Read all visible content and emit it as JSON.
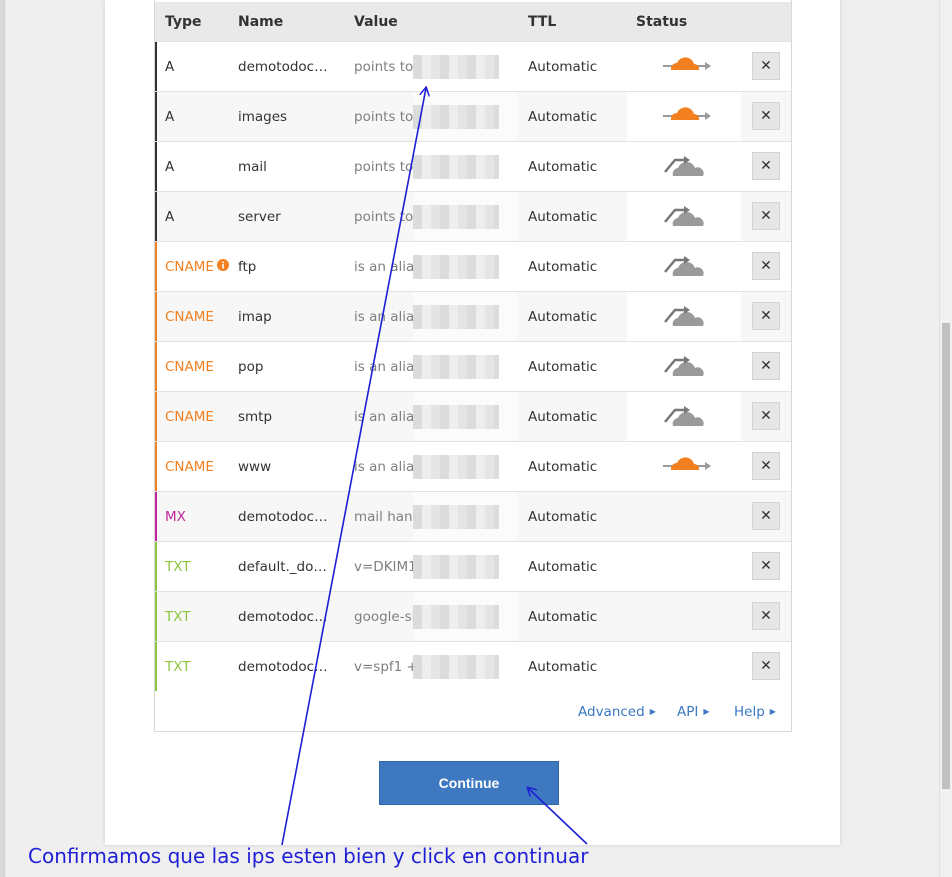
{
  "table": {
    "columns": [
      "Type",
      "Name",
      "Value",
      "TTL",
      "Status"
    ],
    "rows": [
      {
        "type": "A",
        "name": "demotodocu…",
        "value": "points to",
        "ttl": "Automatic",
        "proxied": true
      },
      {
        "type": "A",
        "name": "images",
        "value": "points to",
        "ttl": "Automatic",
        "proxied": true
      },
      {
        "type": "A",
        "name": "mail",
        "value": "points to",
        "ttl": "Automatic",
        "proxied": false
      },
      {
        "type": "A",
        "name": "server",
        "value": "points to",
        "ttl": "Automatic",
        "proxied": false
      },
      {
        "type": "CNAME",
        "name": "ftp",
        "value": "is an alias",
        "ttl": "Automatic",
        "proxied": false,
        "info": true
      },
      {
        "type": "CNAME",
        "name": "imap",
        "value": "is an alias",
        "ttl": "Automatic",
        "proxied": false
      },
      {
        "type": "CNAME",
        "name": "pop",
        "value": "is an alias",
        "ttl": "Automatic",
        "proxied": false
      },
      {
        "type": "CNAME",
        "name": "smtp",
        "value": "is an alias",
        "ttl": "Automatic",
        "proxied": false
      },
      {
        "type": "CNAME",
        "name": "www",
        "value": "is an alias",
        "ttl": "Automatic",
        "proxied": true
      },
      {
        "type": "MX",
        "name": "demotodocu…",
        "value": "mail hand",
        "ttl": "Automatic",
        "proxied": null
      },
      {
        "type": "TXT",
        "name": "default._dom…",
        "value": "v=DKIM1;",
        "ttl": "Automatic",
        "proxied": null
      },
      {
        "type": "TXT",
        "name": "demotodocu…",
        "value": "google-sit",
        "ttl": "Automatic",
        "proxied": null
      },
      {
        "type": "TXT",
        "name": "demotodocu…",
        "value": "v=spf1 +a",
        "ttl": "Automatic",
        "proxied": null
      }
    ],
    "delete_glyph": "✕"
  },
  "links": {
    "advanced": "Advanced",
    "api": "API",
    "help": "Help"
  },
  "continue_label": "Continue",
  "annotation": "Confirmamos que las ips esten bien y click en continuar",
  "colors": {
    "type_A": "#333333",
    "type_CNAME": "#f38020",
    "type_MX": "#c2269b",
    "type_TXT": "#8cc63f",
    "cloud_on": "#f38020",
    "cloud_off": "#9a9a9a",
    "link": "#3a78c3",
    "button": "#3d78c1",
    "annotation": "#1f1fd6"
  }
}
